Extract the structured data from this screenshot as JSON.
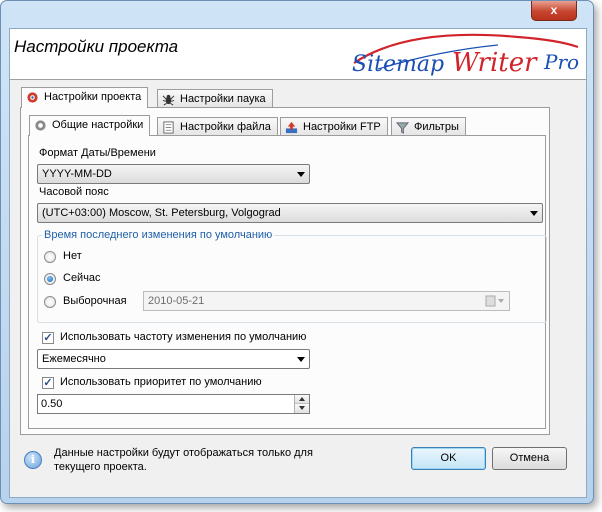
{
  "window": {
    "title": "Настройки проекта",
    "close_glyph": "x"
  },
  "header": {
    "title": "Настройки проекта",
    "logo": {
      "part1": "Sitemap",
      "part2": "Writer",
      "part3": "Pro"
    }
  },
  "outer_tabs": [
    {
      "label": "Настройки проекта",
      "icon": "gear-icon",
      "active": true
    },
    {
      "label": "Настройки паука",
      "icon": "spider-icon",
      "active": false
    }
  ],
  "inner_tabs": [
    {
      "label": "Общие настройки",
      "icon": "gear-icon",
      "active": true
    },
    {
      "label": "Настройки файла",
      "icon": "file-icon",
      "active": false
    },
    {
      "label": "Настройки FTP",
      "icon": "upload-icon",
      "active": false
    },
    {
      "label": "Фильтры",
      "icon": "filter-icon",
      "active": false
    }
  ],
  "general": {
    "date_format_label": "Формат Даты/Времени",
    "date_format_value": "YYYY-MM-DD",
    "timezone_label": "Часовой пояс",
    "timezone_value": "(UTC+03:00) Moscow, St. Petersburg, Volgograd",
    "lastmod_group_title": "Время последнего изменения по умолчанию",
    "lastmod_options": [
      {
        "label": "Нет",
        "checked": false
      },
      {
        "label": "Сейчас",
        "checked": true
      },
      {
        "label": "Выборочная",
        "checked": false
      }
    ],
    "custom_date_value": "2010-05-21",
    "use_changefreq_label": "Использовать частоту изменения по умолчанию",
    "use_changefreq_checked": true,
    "changefreq_value": "Ежемесячно",
    "use_priority_label": "Использовать приоритет по умолчанию",
    "use_priority_checked": true,
    "priority_value": "0.50"
  },
  "footer": {
    "info_line1": "Данные настройки будут отображаться только для",
    "info_line2": "текущего проекта.",
    "ok_label": "OK",
    "cancel_label": "Отмена"
  },
  "colors": {
    "logo_blue": "#1a4fb3",
    "logo_red": "#d2232a",
    "group_title": "#1f5fa8"
  }
}
